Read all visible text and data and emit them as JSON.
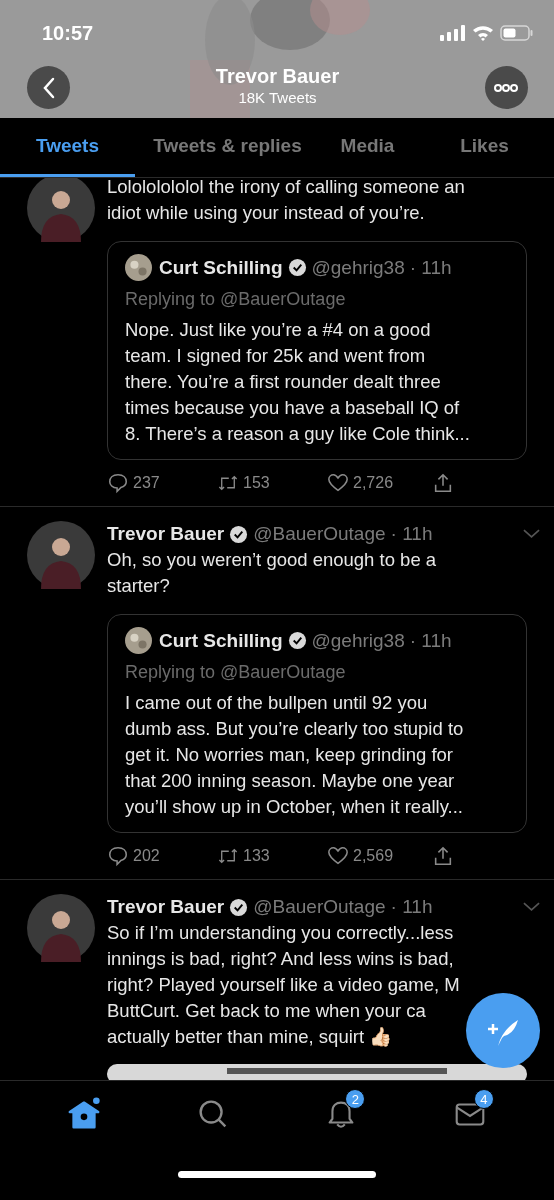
{
  "status_bar": {
    "time": "10:57"
  },
  "header": {
    "title": "Trevor Bauer",
    "subtitle": "18K Tweets"
  },
  "tabs": [
    {
      "label": "Tweets",
      "selected": true
    },
    {
      "label": "Tweets & replies",
      "selected": false
    },
    {
      "label": "Media",
      "selected": false
    },
    {
      "label": "Likes",
      "selected": false
    }
  ],
  "tweets": [
    {
      "lines": [
        "Lolololololol the irony of calling someone an",
        "idiot while using your instead of you’re."
      ],
      "quote": {
        "name": "Curt Schilling",
        "handle": "@gehrig38",
        "time": "· 11h",
        "replying": "Replying to @BauerOutage",
        "lines": [
          "Nope. Just like you’re a #4 on a good",
          "team. I signed for 25k and went from",
          "there. You’re a first rounder dealt three",
          "times because you have a baseball IQ of",
          "8. There’s a reason a guy like Cole think..."
        ]
      },
      "replies": "237",
      "retweets": "153",
      "likes": "2,726"
    },
    {
      "name": "Trevor Bauer",
      "handle": "@BauerOutage",
      "time": "· 11h",
      "lines": [
        "Oh, so you weren’t good enough to be a",
        "starter?"
      ],
      "quote": {
        "name": "Curt Schilling",
        "handle": "@gehrig38",
        "time": "· 11h",
        "replying": "Replying to @BauerOutage",
        "lines": [
          "I came out of the bullpen until 92 you",
          "dumb ass. But you’re clearly too stupid to",
          "get it. No worries man, keep grinding for",
          "that 200 inning season. Maybe one year",
          "you’ll show up in October, when it really..."
        ]
      },
      "replies": "202",
      "retweets": "133",
      "likes": "2,569"
    },
    {
      "name": "Trevor Bauer",
      "handle": "@BauerOutage",
      "time": "· 11h",
      "lines": [
        "So if I’m understanding you correctly...less",
        "innings is bad, right? And less wins is bad,",
        "right? Played yourself like a video game, M",
        "ButtCurt. Get back to me when your ca",
        "actually better than mine, squirt 👍🏻"
      ]
    }
  ],
  "bottom_nav": [
    {
      "kind": "home",
      "selected": true
    },
    {
      "kind": "search",
      "selected": false
    },
    {
      "kind": "bell",
      "selected": false,
      "badge": "2"
    },
    {
      "kind": "mail",
      "selected": false,
      "badge": "4"
    }
  ]
}
